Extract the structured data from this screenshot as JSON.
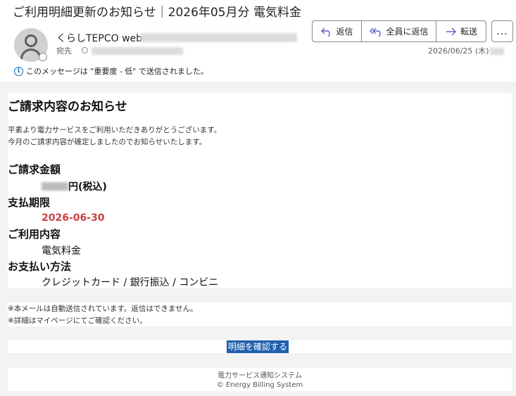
{
  "header": {
    "subject": "ご利用明細更新のお知らせ｜2026年05月分 電気料金",
    "sender_name": "くらしTEPCO web",
    "to_label": "宛先",
    "datetime": "2026/06/25 (木)",
    "importance_notice": "このメッセージは \"重要度 - 低\" で送信されました。",
    "actions": {
      "reply": "返信",
      "reply_all": "全員に返信",
      "forward": "転送",
      "more": "..."
    },
    "icons": {
      "avatar": "person-icon",
      "reply": "reply-arrow-icon",
      "reply_all": "reply-all-arrow-icon",
      "forward": "forward-arrow-icon",
      "info": "info-icon"
    }
  },
  "body": {
    "title": "ご請求内容のお知らせ",
    "intro_line1": "平素より電力サービスをご利用いただきありがとうございます。",
    "intro_line2": "今月のご請求内容が確定しましたのでお知らせいたします。",
    "amount_label": "ご請求金額",
    "amount_unit": "円(税込)",
    "due_label": "支払期限",
    "due_value": "2026-06-30",
    "service_label": "ご利用内容",
    "service_value": "電気料金",
    "payment_label": "お支払い方法",
    "payment_value": "クレジットカード / 銀行振込 / コンビニ",
    "note_line1": "※本メールは自動送信されています。返信はできません。",
    "note_line2": "※詳細はマイページにてご確認ください。",
    "cta_label": "明細を確認する",
    "footer_line1": "電力サービス通知システム",
    "footer_line2": "© Energy Billing System"
  },
  "colors": {
    "accent": "#1f5fae",
    "due_date": "#c94040",
    "background": "#f3f3f3"
  }
}
